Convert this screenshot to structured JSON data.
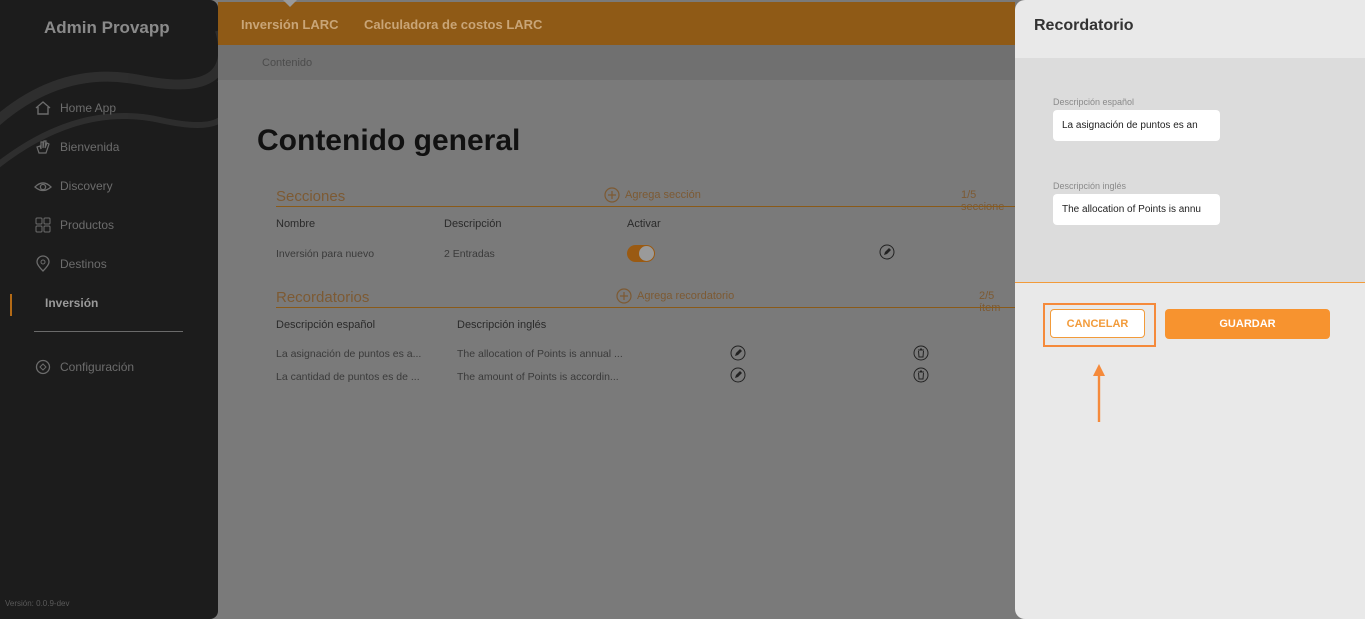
{
  "app": {
    "brand": "Admin Provapp",
    "version": "Versión: 0.0.9-dev"
  },
  "sidebar": {
    "items": [
      {
        "label": "Home App",
        "icon": "home-icon"
      },
      {
        "label": "Bienvenida",
        "icon": "wave-hand-icon"
      },
      {
        "label": "Discovery",
        "icon": "eye-icon"
      },
      {
        "label": "Productos",
        "icon": "grid-icon"
      },
      {
        "label": "Destinos",
        "icon": "location-pin-icon"
      },
      {
        "label": "Inversión",
        "icon": ""
      },
      {
        "label": "Configuración",
        "icon": "settings-icon"
      }
    ],
    "active": "Inversión"
  },
  "topbar": {
    "tabs": [
      "Inversión LARC",
      "Calculadora de costos LARC"
    ]
  },
  "breadcrumb": "Contenido",
  "main": {
    "title": "Contenido general",
    "secciones": {
      "heading": "Secciones",
      "add_label": "Agrega sección",
      "count": "1/5 seccione",
      "columns": [
        "Nombre",
        "Descripción",
        "Activar"
      ],
      "rows": [
        {
          "nombre": "Inversión para nuevo",
          "descripcion": "2 Entradas",
          "activo": true
        }
      ]
    },
    "recordatorios": {
      "heading": "Recordatorios",
      "add_label": "Agrega recordatorio",
      "count": "2/5 ítem",
      "columns": [
        "Descripción español",
        "Descripción inglés"
      ],
      "rows": [
        {
          "es": "La asignación de puntos es a...",
          "en": "The allocation of Points is annual ..."
        },
        {
          "es": "La cantidad de puntos es de ...",
          "en": "The amount of Points is accordin..."
        }
      ]
    }
  },
  "drawer": {
    "title": "Recordatorio",
    "es_label": "Descripción español",
    "es_value": "La asignación de puntos es an",
    "en_label": "Descripción inglés",
    "en_value": "The allocation of Points is annu",
    "cancel_label": "CANCELAR",
    "save_label": "GUARDAR"
  },
  "colors": {
    "accent": "#f7932f",
    "highlight": "#f58a3b"
  }
}
